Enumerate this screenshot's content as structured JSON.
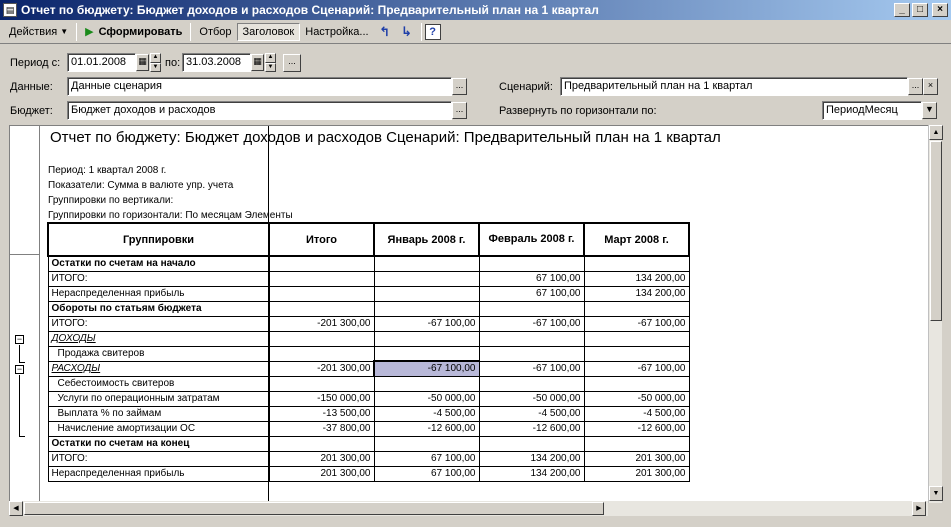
{
  "window": {
    "title": "Отчет по бюджету: Бюджет доходов и расходов Сценарий: Предварительный план на 1 квартал",
    "minimize": "_",
    "maximize": "□",
    "close": "×"
  },
  "toolbar": {
    "actions": "Действия",
    "generate": "Сформировать",
    "filter": "Отбор",
    "header": "Заголовок",
    "settings": "Настройка...",
    "help": "?"
  },
  "form": {
    "period_label": "Период с:",
    "period_from": "01.01.2008",
    "period_to_label": "по:",
    "period_to": "31.03.2008",
    "data_label": "Данные:",
    "data_value": "Данные сценария",
    "budget_label": "Бюджет:",
    "budget_value": "Бюджет доходов и расходов",
    "scenario_label": "Сценарий:",
    "scenario_value": "Предварительный план на 1 квартал",
    "expand_label": "Развернуть по горизонтали по:",
    "expand_value": "ПериодМесяц",
    "ellipsis": "...",
    "clear": "×",
    "dropdown": "▼"
  },
  "report": {
    "title": "Отчет по бюджету: Бюджет доходов и расходов Сценарий: Предварительный план на 1 квартал",
    "period_line": "Период: 1 квартал 2008 г.",
    "indicators_line": "Показатели:  Сумма в валюте упр. учета",
    "vgroup_line": "Группировки по вертикали:",
    "hgroup_line": "Группировки по горизонтали:  По месяцам Элементы",
    "headers": [
      "Группировки",
      "Итого",
      "Январь 2008 г.",
      "Февраль 2008 г.",
      "Март 2008 г."
    ],
    "rows": [
      {
        "type": "sec",
        "cells": [
          "Остатки по счетам на начало",
          "",
          "",
          "",
          ""
        ]
      },
      {
        "type": "row",
        "cells": [
          "ИТОГО:",
          "",
          "",
          "67 100,00",
          "134 200,00"
        ]
      },
      {
        "type": "row",
        "cells": [
          "Нераспределенная прибыль",
          "",
          "",
          "67 100,00",
          "134 200,00"
        ]
      },
      {
        "type": "sec",
        "cells": [
          "Обороты по статьям бюджета",
          "",
          "",
          "",
          ""
        ]
      },
      {
        "type": "row",
        "cells": [
          "ИТОГО:",
          "-201 300,00",
          "-67 100,00",
          "-67 100,00",
          "-67 100,00"
        ]
      },
      {
        "type": "ital",
        "cells": [
          "ДОХОДЫ",
          "",
          "",
          "",
          ""
        ]
      },
      {
        "type": "ind",
        "cells": [
          "Продажа свитеров",
          "",
          "",
          "",
          ""
        ]
      },
      {
        "type": "ital",
        "cells": [
          "РАСХОДЫ",
          "-201 300,00",
          "-67 100,00",
          "-67 100,00",
          "-67 100,00"
        ]
      },
      {
        "type": "ind",
        "cells": [
          "Себестоимость свитеров",
          "",
          "",
          "",
          ""
        ]
      },
      {
        "type": "ind",
        "cells": [
          "Услуги по операционным затратам",
          "-150 000,00",
          "-50 000,00",
          "-50 000,00",
          "-50 000,00"
        ]
      },
      {
        "type": "ind",
        "cells": [
          "Выплата % по займам",
          "-13 500,00",
          "-4 500,00",
          "-4 500,00",
          "-4 500,00"
        ]
      },
      {
        "type": "ind",
        "cells": [
          "Начисление амортизации ОС",
          "-37 800,00",
          "-12 600,00",
          "-12 600,00",
          "-12 600,00"
        ]
      },
      {
        "type": "sec",
        "cells": [
          "Остатки по счетам на конец",
          "",
          "",
          "",
          ""
        ]
      },
      {
        "type": "row",
        "cells": [
          "ИТОГО:",
          "201 300,00",
          "67 100,00",
          "134 200,00",
          "201 300,00"
        ]
      },
      {
        "type": "row",
        "cells": [
          "Нераспределенная прибыль",
          "201 300,00",
          "67 100,00",
          "134 200,00",
          "201 300,00"
        ]
      }
    ]
  }
}
